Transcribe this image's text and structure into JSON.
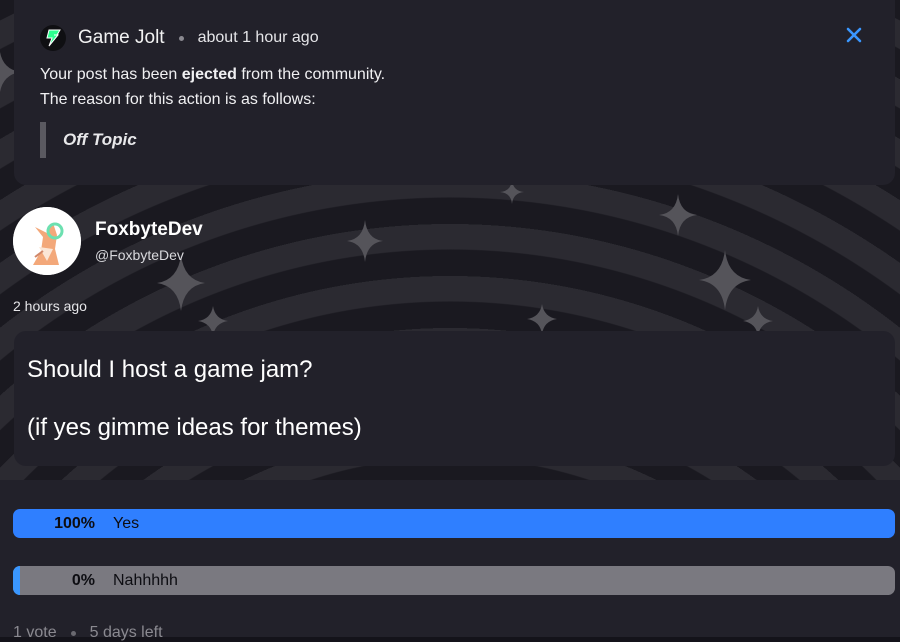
{
  "notification": {
    "source": "Game Jolt",
    "time": "about 1 hour ago",
    "message_prefix": "Your post has been ",
    "message_bold": "ejected",
    "message_suffix": " from the community.",
    "reason_intro": "The reason for this action is as follows:",
    "reason": "Off Topic"
  },
  "author": {
    "name": "FoxbyteDev",
    "handle": "@FoxbyteDev",
    "posted": "2 hours ago"
  },
  "post": {
    "line1": "Should I host a game jam?",
    "line2": "(if yes gimme ideas for themes)"
  },
  "poll": {
    "options": [
      {
        "percent": "100%",
        "label": "Yes",
        "share": 1.0
      },
      {
        "percent": "0%",
        "label": "Nahhhhh",
        "share": 0.0
      }
    ],
    "votes": "1 vote",
    "remaining": "5 days left"
  },
  "colors": {
    "accent": "#2f7fff",
    "card": "#22212a",
    "logo_green": "#2cff8f"
  },
  "icons": {
    "close": "close-icon",
    "logo": "game-jolt-logo-icon"
  }
}
